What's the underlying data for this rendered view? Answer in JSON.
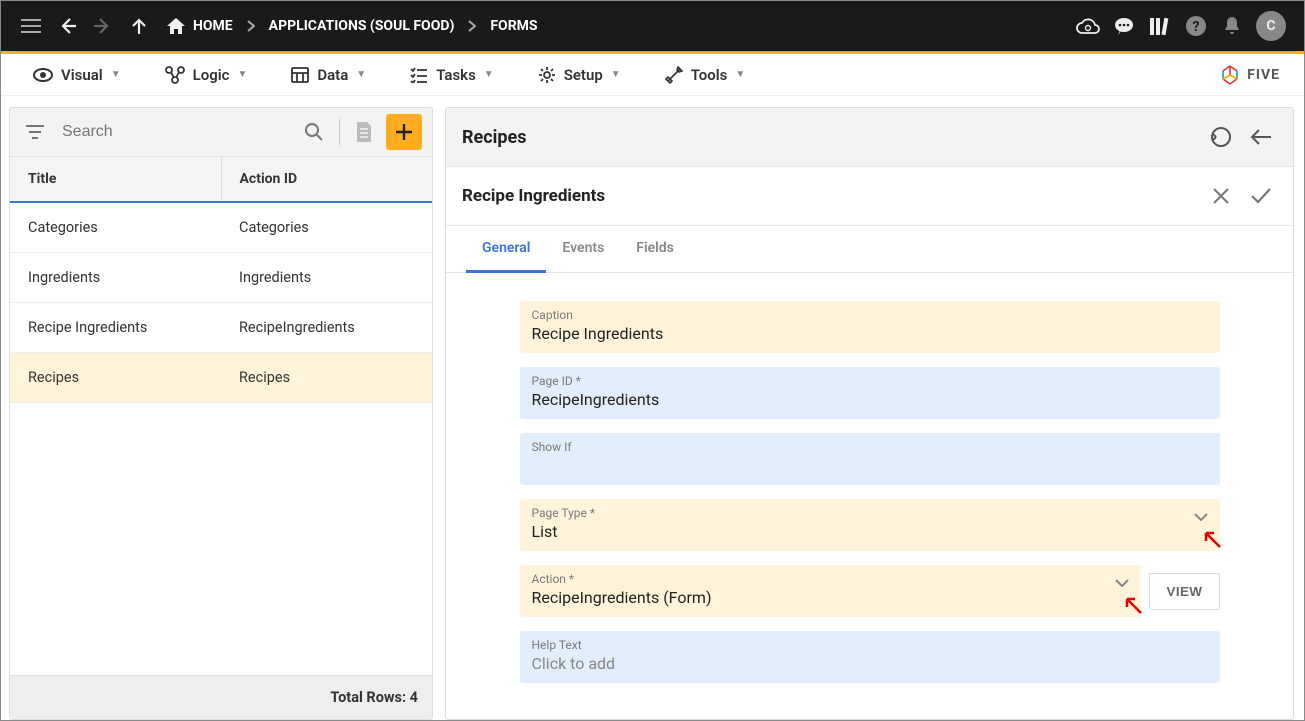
{
  "breadcrumb": {
    "home": "HOME",
    "app": "APPLICATIONS (SOUL FOOD)",
    "page": "FORMS"
  },
  "avatar": "C",
  "menu": {
    "visual": "Visual",
    "logic": "Logic",
    "data": "Data",
    "tasks": "Tasks",
    "setup": "Setup",
    "tools": "Tools"
  },
  "brand": "FIVE",
  "left": {
    "search_placeholder": "Search",
    "headers": {
      "title": "Title",
      "action_id": "Action ID"
    },
    "rows": [
      {
        "title": "Categories",
        "action_id": "Categories",
        "active": false
      },
      {
        "title": "Ingredients",
        "action_id": "Ingredients",
        "active": false
      },
      {
        "title": "Recipe Ingredients",
        "action_id": "RecipeIngredients",
        "active": false
      },
      {
        "title": "Recipes",
        "action_id": "Recipes",
        "active": true
      }
    ],
    "footer": "Total Rows: 4"
  },
  "right": {
    "header_title": "Recipes",
    "sub_title": "Recipe Ingredients",
    "tabs": {
      "general": "General",
      "events": "Events",
      "fields": "Fields"
    },
    "fields": {
      "caption": {
        "label": "Caption",
        "value": "Recipe Ingredients"
      },
      "page_id": {
        "label": "Page ID *",
        "value": "RecipeIngredients"
      },
      "show_if": {
        "label": "Show If",
        "value": ""
      },
      "page_type": {
        "label": "Page Type *",
        "value": "List"
      },
      "action": {
        "label": "Action *",
        "value": "RecipeIngredients (Form)"
      },
      "help": {
        "label": "Help Text",
        "value": "Click to add"
      }
    },
    "view_btn": "VIEW"
  }
}
